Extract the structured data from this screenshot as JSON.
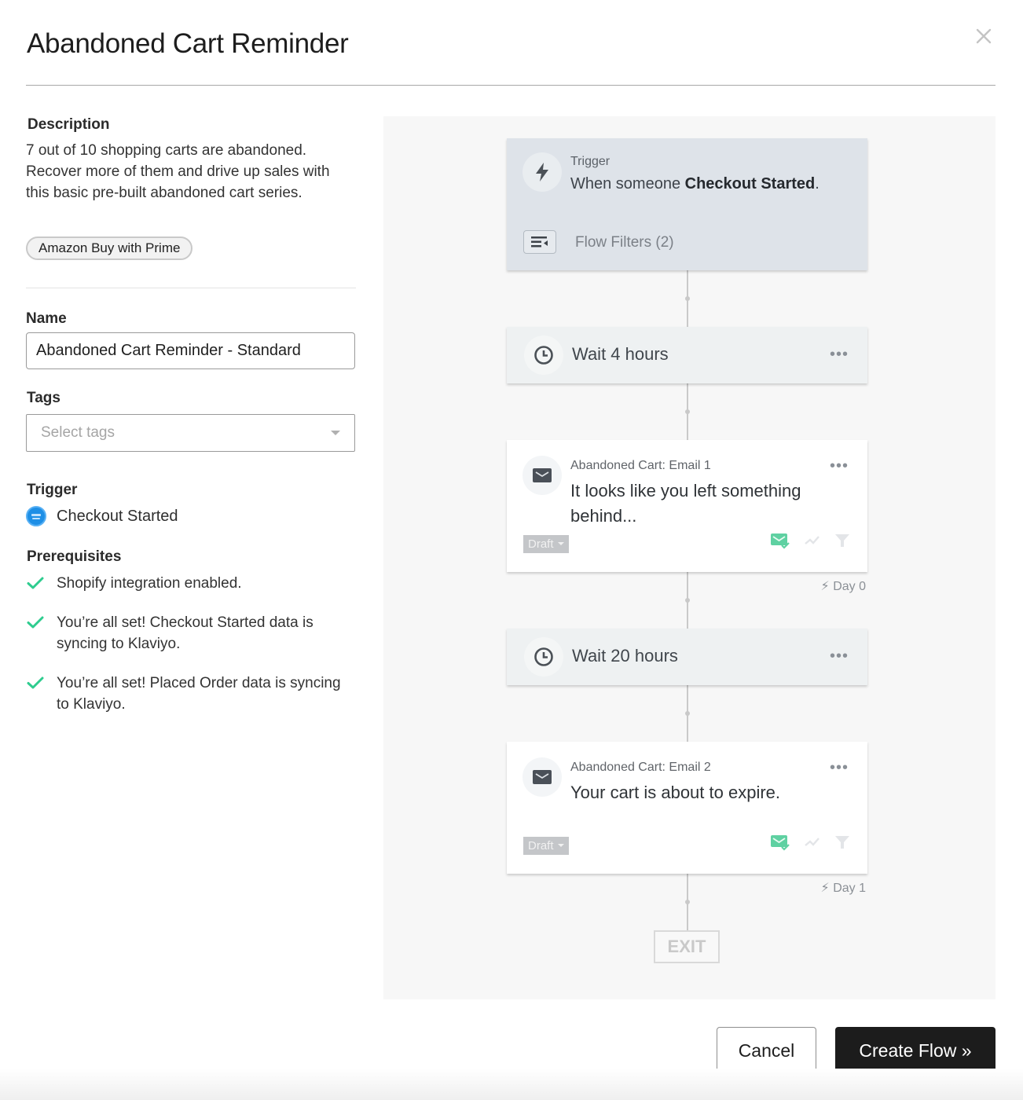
{
  "modal": {
    "title": "Abandoned Cart Reminder",
    "close_icon": "close-icon"
  },
  "details": {
    "description_label": "Description",
    "description_text": "7 out of 10 shopping carts are abandoned. Recover more of them and drive up sales with this basic pre-built abandoned cart series.",
    "tag_pill": "Amazon Buy with Prime",
    "name_label": "Name",
    "name_value": "Abandoned Cart Reminder - Standard",
    "tags_label": "Tags",
    "tags_placeholder": "Select tags",
    "trigger_label": "Trigger",
    "trigger_value": "Checkout Started",
    "trigger_icon": "amazon-prime-icon",
    "prerequisites_label": "Prerequisites",
    "prerequisites": [
      {
        "text": "Shopify integration enabled.",
        "status": "complete"
      },
      {
        "text": "You’re all set! Checkout Started data is syncing to Klaviyo.",
        "status": "complete"
      },
      {
        "text": "You’re all set! Placed Order data is syncing to Klaviyo.",
        "status": "complete"
      }
    ]
  },
  "flow": {
    "trigger": {
      "small_label": "Trigger",
      "main_prefix": "When someone ",
      "main_bold": "Checkout Started",
      "main_suffix": ".",
      "filters_label": "Flow Filters (2)"
    },
    "wait_1": {
      "label": "Wait 4 hours",
      "menu": "•••"
    },
    "email_1": {
      "name": "Abandoned Cart: Email 1",
      "subject": "It looks like you left something behind...",
      "status": "Draft",
      "menu": "•••",
      "day": "Day 0"
    },
    "wait_2": {
      "label": "Wait 20 hours",
      "menu": "•••"
    },
    "email_2": {
      "name": "Abandoned Cart: Email 2",
      "subject": "Your cart is about to expire.",
      "status": "Draft",
      "menu": "•••",
      "day": "Day 1"
    },
    "exit_label": "EXIT"
  },
  "footer": {
    "cancel_label": "Cancel",
    "create_label": "Create Flow »"
  },
  "colors": {
    "accent_dark": "#1c1c1c",
    "check_green": "#2ecc8f",
    "trigger_card": "#dee3e9",
    "prime_blue": "#1e8fe6"
  }
}
